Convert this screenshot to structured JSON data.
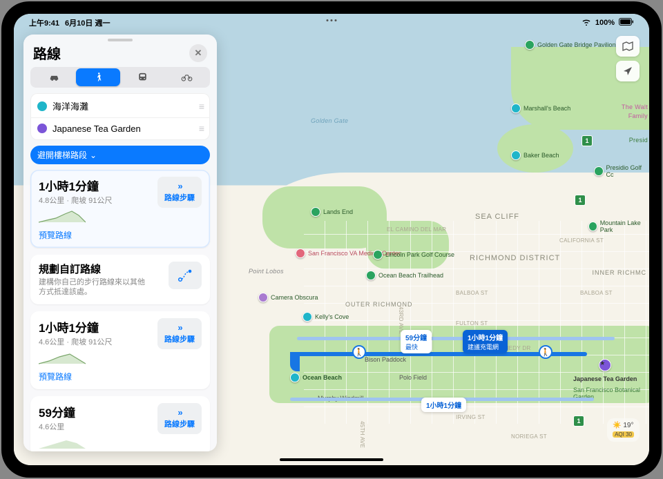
{
  "status": {
    "time": "上午9:41",
    "date": "6月10日 週一",
    "battery": "100%"
  },
  "panel": {
    "title": "路線",
    "modes": [
      "car",
      "walk",
      "transit",
      "bike"
    ],
    "active_mode": "walk",
    "stops": {
      "from": "海洋海灘",
      "to": "Japanese Tea Garden"
    },
    "avoid_label": "避開樓梯路段",
    "steps_button": "路線步驟",
    "preview_link": "預覽路線",
    "custom": {
      "title": "規劃自訂路線",
      "desc": "建構你自己的步行路線來以其他方式抵達該處。"
    },
    "routes": [
      {
        "time": "1小時1分鐘",
        "sub": "4.8公里 · 爬坡 91公尺",
        "selected": true,
        "preview": true
      },
      {
        "time": "1小時1分鐘",
        "sub": "4.6公里 · 爬坡 91公尺",
        "selected": false,
        "preview": true
      },
      {
        "time": "59分鐘",
        "sub": "4.6公里",
        "selected": false,
        "preview": false
      }
    ]
  },
  "map": {
    "water_label": "Golden Gate",
    "pois": {
      "bridge_pav": "Golden Gate Bridge Pavilion",
      "marshall": "Marshall's Beach",
      "baker": "Baker Beach",
      "presidio": "Presidio Golf Cc",
      "mountain_lake": "Mountain Lake Park",
      "lands_end": "Lands End",
      "sfva": "San Francisco VA Medical Center",
      "lincoln": "Lincoln Park Golf Course",
      "ob_trail": "Ocean Beach Trailhead",
      "kelly": "Kelly's Cove",
      "obscura": "Camera Obscura",
      "point_lobos": "Point Lobos",
      "bison": "Bison Paddock",
      "polo": "Polo Field",
      "murphy": "Murphy Windmill",
      "ocean_beach": "Ocean Beach",
      "tea_garden": "Japanese Tea Garden",
      "sfbg": "San Francisco Botanical Garden",
      "walt": "The Walt",
      "family": "Family",
      "presid": "Presid"
    },
    "districts": {
      "seacliff": "SEA CLIFF",
      "richmond": "RICHMOND DISTRICT",
      "outer": "OUTER RICHMOND",
      "inner": "INNER RICHMC"
    },
    "streets": {
      "caminodelmar": "EL CAMINO DEL MAR",
      "california": "CALIFORNIA ST",
      "balboa": "BALBOA ST",
      "balboa2": "BALBOA ST",
      "fulton": "FULTON ST",
      "jfk": "JOHN F KENNEDY DR",
      "irving": "IRVING ST",
      "ave43": "43RD AVE",
      "ave45": "45TH AVE",
      "noriega": "NORIEGA ST"
    },
    "shields": {
      "one": "1"
    },
    "callouts": {
      "c59": {
        "t": "59分鐘",
        "s": "最快"
      },
      "c1h": {
        "t": "1小時1分鐘",
        "s": "建議充電網"
      },
      "c1halt": "1小時1分鐘"
    },
    "weather": {
      "temp": "19°",
      "aqi": "AQI 30"
    }
  }
}
